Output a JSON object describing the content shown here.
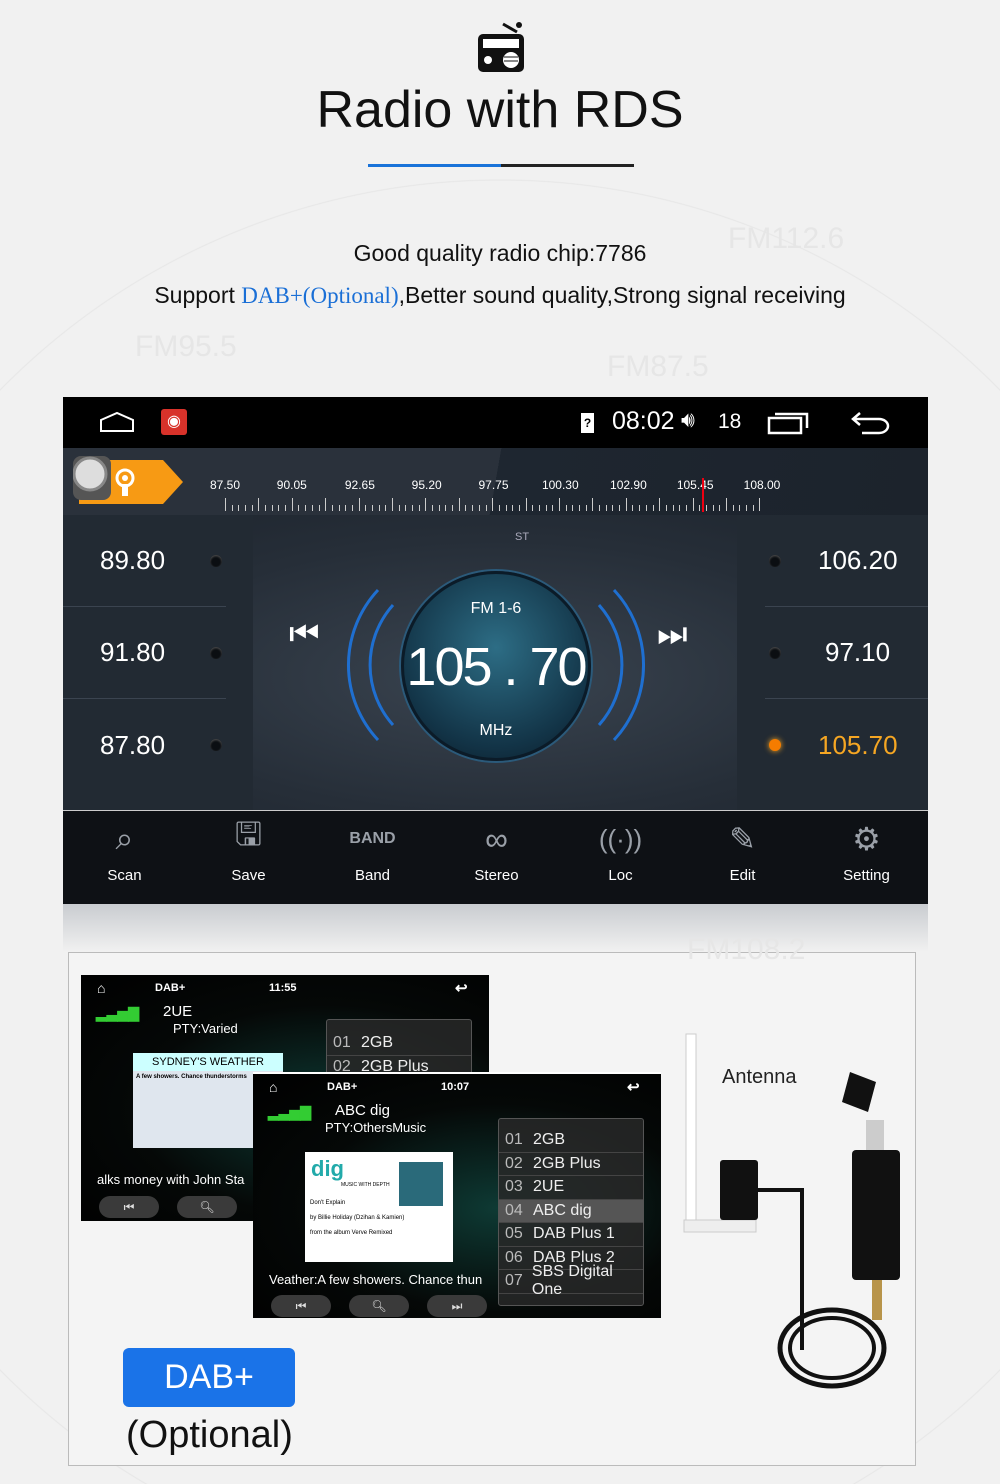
{
  "header": {
    "title": "Radio with RDS",
    "line1": "Good quality radio chip:7786",
    "line2_pre": "Support ",
    "line2_dab": "DAB+(Optional)",
    "line2_post": ",Better sound quality,Strong signal receiving",
    "accent": "#1a73d9"
  },
  "watermarks": [
    "FM112.6",
    "FM95.5",
    "FM87.5",
    "FM108.2"
  ],
  "radio": {
    "status": {
      "time": "08:02",
      "volume": "18"
    },
    "scale": [
      "87.50",
      "90.05",
      "92.65",
      "95.20",
      "97.75",
      "100.30",
      "102.90",
      "105.45",
      "108.00"
    ],
    "stereo": "ST",
    "band": "FM 1-6",
    "frequency": "105 . 70",
    "unit": "MHz",
    "presets_left": [
      "89.80",
      "91.80",
      "87.80"
    ],
    "presets_right": [
      "106.20",
      "97.10",
      "105.70"
    ],
    "active_color": "#f5a623",
    "toolbar": [
      "Scan",
      "Save",
      "Band",
      "Stereo",
      "Loc",
      "Edit",
      "Setting"
    ]
  },
  "dab1": {
    "title": "DAB+",
    "time": "11:55",
    "station": "2UE",
    "pty": "PTY:Varied",
    "slide_title": "SYDNEY'S WEATHER",
    "slide_text": "A few showers. Chance thunderstorms",
    "ticker": "alks money with John Sta",
    "list": [
      [
        "01",
        "2GB"
      ],
      [
        "02",
        "2GB Plus"
      ]
    ]
  },
  "dab2": {
    "title": "DAB+",
    "time": "10:07",
    "station": "ABC dig",
    "pty": "PTY:OthersMusic",
    "slide_logo": "dig",
    "slide_tag": "MUSIC WITH DEPTH",
    "song": "Don't Explain",
    "artist": "by Billie Holiday (Dzihan & Kamien)",
    "album": "from the album Verve Remixed",
    "ticker": "Veather:A few showers. Chance thun",
    "list": [
      [
        "01",
        "2GB"
      ],
      [
        "02",
        "2GB Plus"
      ],
      [
        "03",
        "2UE"
      ],
      [
        "04",
        "ABC dig"
      ],
      [
        "05",
        "DAB Plus 1"
      ],
      [
        "06",
        "DAB Plus 2"
      ],
      [
        "07",
        "SBS Digital One"
      ]
    ]
  },
  "antenna_label": "Antenna",
  "badge": {
    "label": "DAB+",
    "note": "(Optional)",
    "color": "#1a73e8"
  }
}
